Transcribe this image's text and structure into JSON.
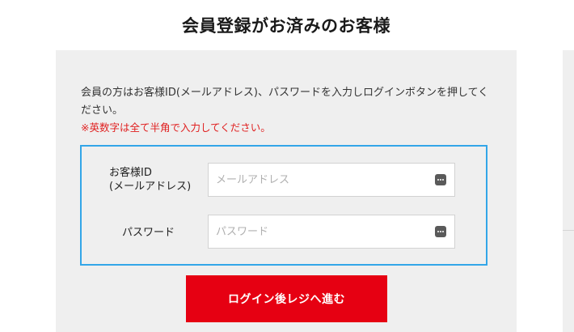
{
  "page": {
    "title": "会員登録がお済みのお客様"
  },
  "login": {
    "instruction": "会員の方はお客様ID(メールアドレス)、パスワードを入力しログインボタンを押してください。",
    "notice": "※英数字は全て半角で入力してください。",
    "id_field": {
      "label_line1": "お客様ID",
      "label_line2": "(メールアドレス)",
      "placeholder": "メールアドレス",
      "value": ""
    },
    "password_field": {
      "label": "パスワード",
      "placeholder": "パスワード",
      "value": ""
    },
    "submit_label": "ログイン後レジへ進む"
  },
  "colors": {
    "accent_button": "#e60012",
    "form_border": "#33a6e8",
    "notice_text": "#e02020",
    "panel_background": "#efefef"
  },
  "icons": {
    "field_icon": "password-manager-key-icon"
  }
}
